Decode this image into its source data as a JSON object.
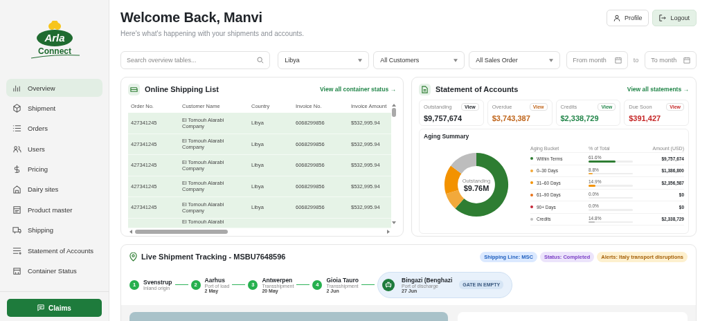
{
  "sidebar": {
    "logo": {
      "line_1": "Arla",
      "line_2": "Connect"
    },
    "nav_items": [
      {
        "label": "Overview",
        "selected": true
      },
      {
        "label": "Shipment",
        "selected": false
      },
      {
        "label": "Orders",
        "selected": false
      },
      {
        "label": "Users",
        "selected": false
      },
      {
        "label": "Pricing",
        "selected": false
      },
      {
        "label": "Dairy sites",
        "selected": false
      },
      {
        "label": "Product master",
        "selected": false
      },
      {
        "label": "Shipping",
        "selected": false
      },
      {
        "label": "Statement of Accounts",
        "selected": false
      },
      {
        "label": "Container Status",
        "selected": false
      }
    ],
    "claims_button": "Claims"
  },
  "header": {
    "title": "Welcome Back, Manvi",
    "subtitle": "Here's what's happening with your shipments and accounts.",
    "profile_button": "Profile",
    "logout_button": "Logout"
  },
  "filters": {
    "search": {
      "placeholder": "Search overview tables..."
    },
    "selects": [
      {
        "value": "Libya"
      },
      {
        "value": "All Customers"
      },
      {
        "value": "All Sales Order"
      }
    ],
    "from_month": {
      "placeholder": "From month"
    },
    "separator": "to",
    "to_month": {
      "placeholder": "To month"
    }
  },
  "shipping_list": {
    "title": "Online Shipping List",
    "link": "View all container status →",
    "columns": [
      "Order No.",
      "Customer Name",
      "Country",
      "Invoice No.",
      "Invoice Amount"
    ],
    "rows": [
      [
        "427341245",
        "El Tomouh Alarabi Company",
        "Libya",
        "6068299856",
        "$532,995.94"
      ],
      [
        "427341245",
        "El Tomouh Alarabi Company",
        "Libya",
        "6068299856",
        "$532,995.94"
      ],
      [
        "427341245",
        "El Tomouh Alarabi Company",
        "Libya",
        "6068299856",
        "$532,995.94"
      ],
      [
        "427341245",
        "El Tomouh Alarabi Company",
        "Libya",
        "6068299856",
        "$532,995.94"
      ],
      [
        "427341245",
        "El Tomouh Alarabi Company",
        "Libya",
        "6068299856",
        "$532,995.94"
      ]
    ],
    "partial_row": {
      "customer": "El Tomouh Alarabi"
    }
  },
  "statement": {
    "title": "Statement of Accounts",
    "link": "View all statements →",
    "summary_cards": [
      {
        "label": "Outstanding",
        "value": "$9,757,674",
        "button": "View",
        "color": "#1f2328"
      },
      {
        "label": "Overdue",
        "value": "$3,743,387",
        "button": "View",
        "color": "#c0661c"
      },
      {
        "label": "Credits",
        "value": "$2,338,729",
        "button": "View",
        "color": "#23864a"
      },
      {
        "label": "Due Soon",
        "value": "$391,427",
        "button": "View",
        "color": "#c62828"
      }
    ],
    "aging_summary": {
      "title": "Aging Summary",
      "center_label": "Outstanding",
      "center_value": "$9.76M",
      "columns": [
        "Aging Bucket",
        "% of Total",
        "Amount (USD)"
      ],
      "buckets": [
        {
          "name": "Within Terms",
          "color": "#2e7d32",
          "percent": "61.6%",
          "level": 0.616,
          "amount": "$9,757,674"
        },
        {
          "name": "0–30 Days",
          "color": "#f2a93b",
          "percent": "8.8%",
          "level": 0.088,
          "amount": "$1,386,800"
        },
        {
          "name": "31–60 Days",
          "color": "#f39200",
          "percent": "14.9%",
          "level": 0.149,
          "amount": "$2,356,587"
        },
        {
          "name": "61–90 Days",
          "color": "#e8731a",
          "percent": "0.0%",
          "level": 0,
          "amount": "$0"
        },
        {
          "name": "90+ Days",
          "color": "#c62838",
          "percent": "0.0%",
          "level": 0,
          "amount": "$0"
        },
        {
          "name": "Credits",
          "color": "#bdbdbd",
          "percent": "14.8%",
          "level": 0.148,
          "amount": "$2,338,729"
        }
      ]
    }
  },
  "tracking": {
    "title": "Live Shipment Tracking - MSBU7648596",
    "tags": [
      {
        "label": "Shipping Line: MSC",
        "color": "#dbe9ff"
      },
      {
        "label": "Status: Completed",
        "color": "#ece4fb"
      },
      {
        "label": "Alerts: Italy transport disruptions",
        "color": "#fdf0cf"
      }
    ],
    "steps": [
      {
        "kind": "done",
        "number": "1",
        "name": "Svenstrup",
        "role": "Inland origin"
      },
      {
        "kind": "done",
        "number": "2",
        "name": "Aarhus",
        "role": "Port of load",
        "date": "2 May"
      },
      {
        "kind": "done",
        "number": "3",
        "name": "Antwerpen",
        "role": "Transshipment",
        "date": "20 May"
      },
      {
        "kind": "done",
        "number": "4",
        "name": "Gioia Tauro",
        "role": "Transshipment",
        "date": "2 Jun"
      },
      {
        "kind": "current",
        "name": "Bingazi (Benghazi",
        "role": "Port of discharge",
        "date": "27 Jun",
        "badge": "GATE IN EMPTY"
      }
    ]
  }
}
